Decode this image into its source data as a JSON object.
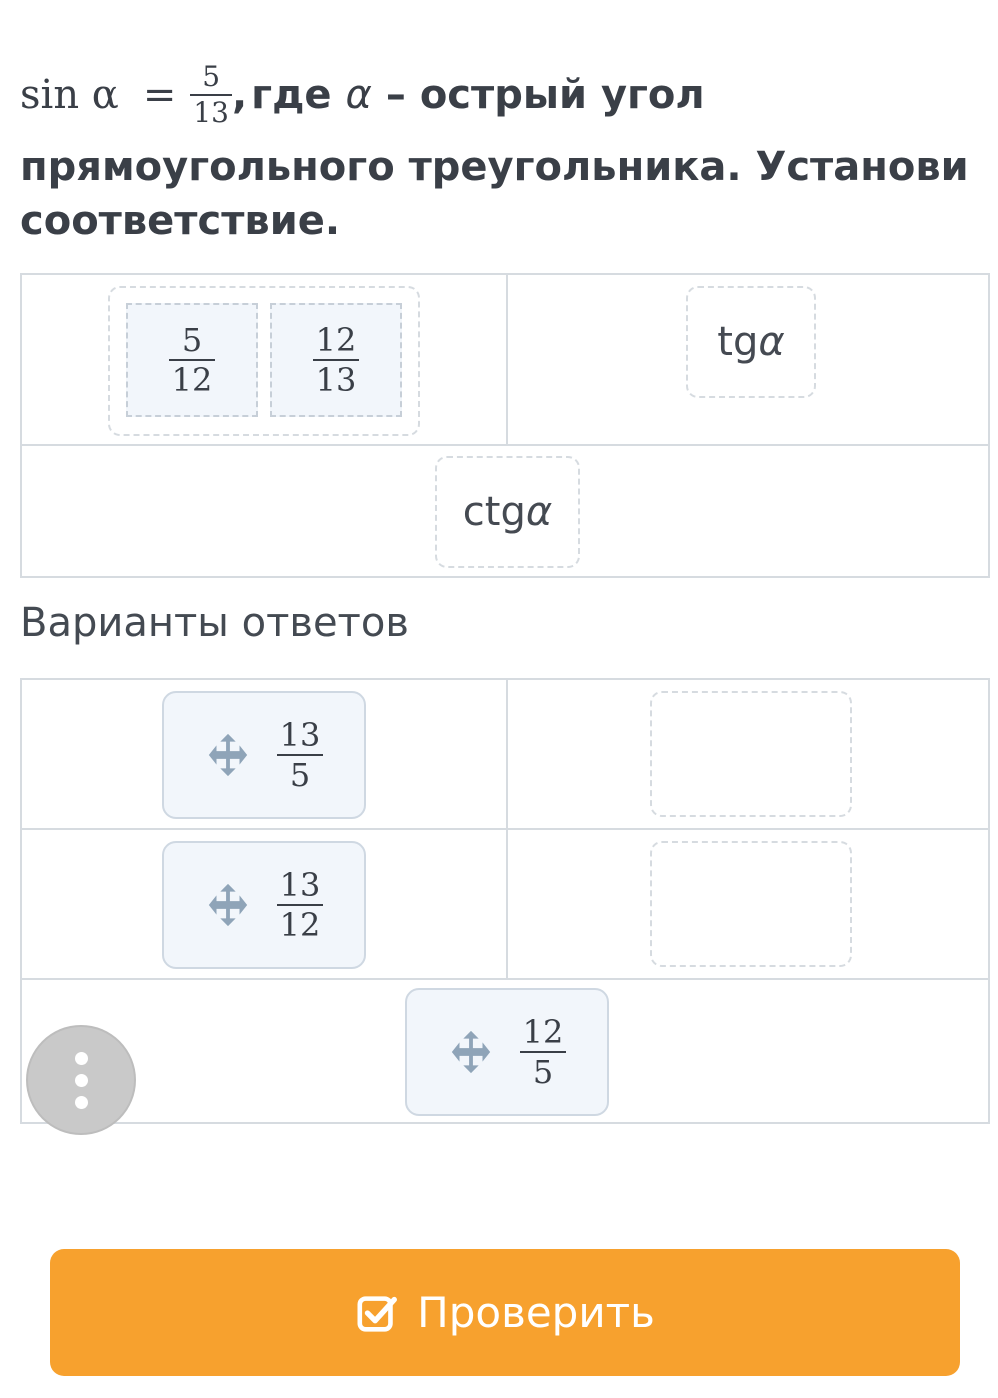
{
  "question": {
    "sin_label": "sin α",
    "equals": "=",
    "fraction": {
      "num": "5",
      "den": "13"
    },
    "rest_comma": ",",
    "rest_where": "где",
    "alpha": "α",
    "rest_line1": "– острый угол",
    "rest_line2": "прямоугольного треугольника. Установи",
    "rest_line3": "соответствие."
  },
  "match": {
    "cos_answers": [
      {
        "num": "5",
        "den": "12"
      },
      {
        "num": "12",
        "den": "13"
      }
    ],
    "tg_label": "tg",
    "ctg_label": "ctg",
    "alpha": "α"
  },
  "answers_title": "Варианты ответов",
  "answers": [
    {
      "num": "13",
      "den": "5"
    },
    {
      "num": "13",
      "den": "12"
    },
    {
      "num": "12",
      "den": "5"
    }
  ],
  "check_button": {
    "label": "Проверить",
    "icon": "checkbox-check-icon"
  },
  "more_button": {
    "icon": "more-vertical-icon"
  },
  "colors": {
    "accent": "#f7a12e",
    "chip_bg": "#f2f6fb",
    "border": "#d6dbe0"
  }
}
